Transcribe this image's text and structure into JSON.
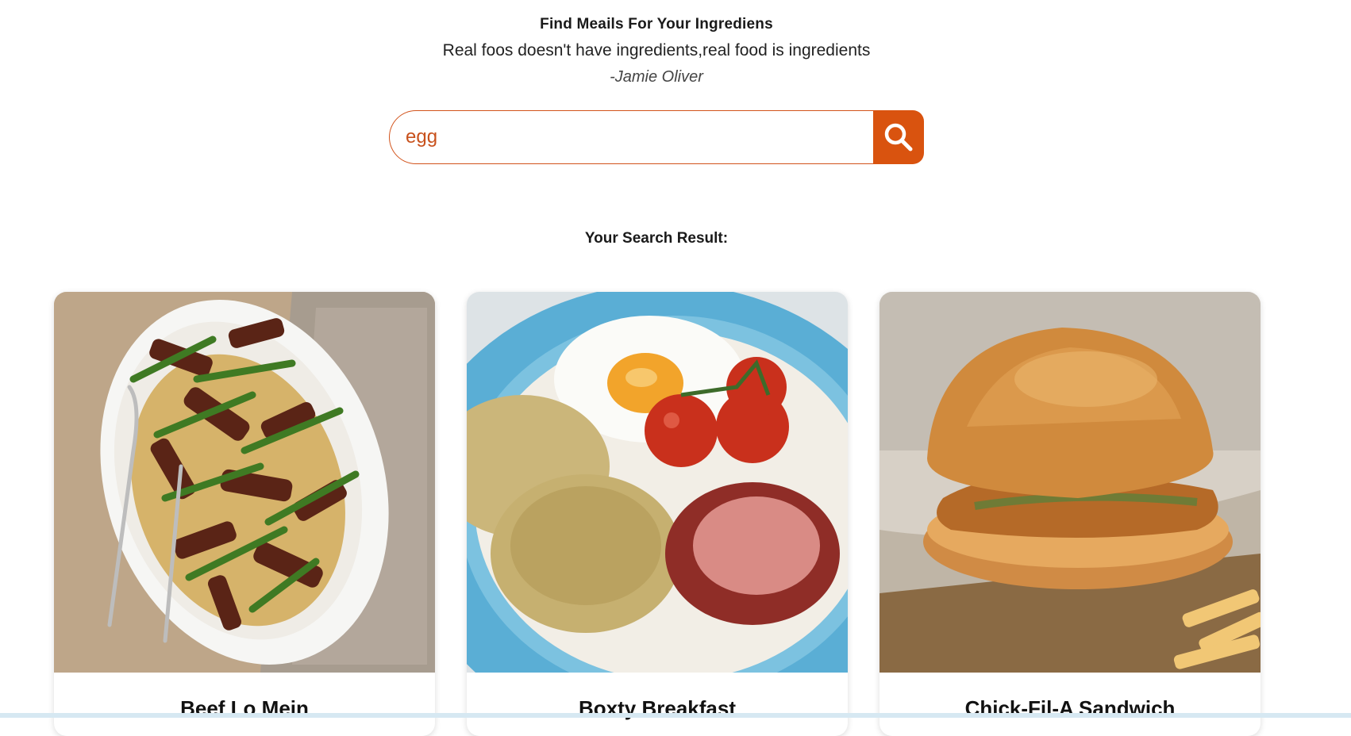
{
  "hero": {
    "title": "Find Meails For Your Ingrediens",
    "quote": "Real foos doesn't have ingredients,real food is ingredients",
    "author": "-Jamie Oliver"
  },
  "search": {
    "value": "egg",
    "button_icon": "search-icon"
  },
  "results": {
    "heading": "Your Search Result:",
    "cards": [
      {
        "title": "Beef Lo Mein",
        "image": "beef-lo-mein-photo"
      },
      {
        "title": "Boxty Breakfast",
        "image": "boxty-breakfast-photo"
      },
      {
        "title": "Chick-Fil-A Sandwich",
        "image": "chick-fil-a-sandwich-photo"
      }
    ]
  },
  "colors": {
    "accent": "#d9530f",
    "input_text": "#c8511c"
  }
}
